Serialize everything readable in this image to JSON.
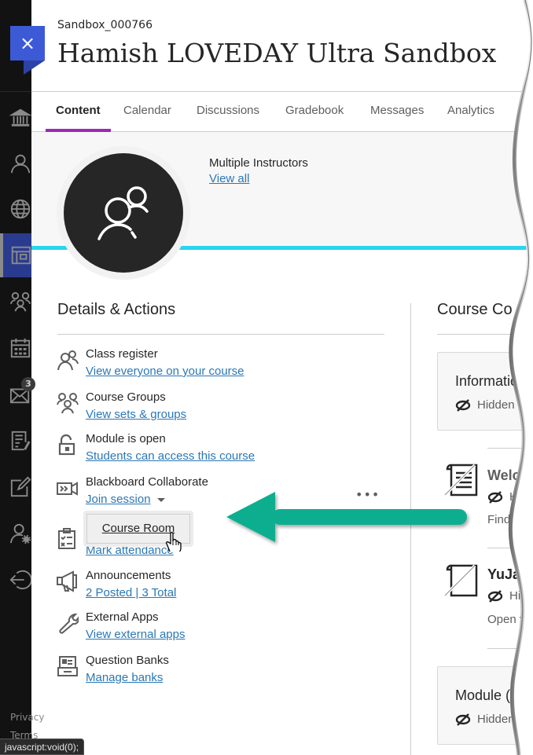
{
  "header": {
    "close_label": "×",
    "course_id": "Sandbox_000766",
    "course_title": "Hamish LOVEDAY Ultra Sandbox"
  },
  "tabs": [
    {
      "label": "Content",
      "active": true
    },
    {
      "label": "Calendar",
      "active": false
    },
    {
      "label": "Discussions",
      "active": false
    },
    {
      "label": "Gradebook",
      "active": false
    },
    {
      "label": "Messages",
      "active": false
    },
    {
      "label": "Analytics",
      "active": false
    }
  ],
  "rail": {
    "items": [
      {
        "icon": "institution-icon"
      },
      {
        "icon": "profile-icon"
      },
      {
        "icon": "globe-icon"
      },
      {
        "icon": "courses-icon",
        "active": true
      },
      {
        "icon": "groups-icon"
      },
      {
        "icon": "calendar-icon"
      },
      {
        "icon": "messages-icon",
        "badge": "3"
      },
      {
        "icon": "grades-icon"
      },
      {
        "icon": "edit-icon"
      },
      {
        "icon": "user-settings-icon"
      },
      {
        "icon": "sign-out-icon"
      }
    ],
    "footer": [
      "Privacy",
      "Terms"
    ]
  },
  "banner": {
    "instructors_label": "Multiple Instructors",
    "view_all": "View all",
    "accent_color": "#2bd4ef"
  },
  "details": {
    "title": "Details & Actions",
    "actions": [
      {
        "icon": "class-register-icon",
        "title": "Class register",
        "link": "View everyone on your course"
      },
      {
        "icon": "course-groups-icon",
        "title": "Course Groups",
        "link": "View sets & groups"
      },
      {
        "icon": "unlock-icon",
        "title": "Module is open",
        "link": "Students can access this course"
      },
      {
        "icon": "video-camera-icon",
        "title": "Blackboard Collaborate",
        "link": "Join session"
      },
      {
        "icon": "attendance-icon",
        "title": "",
        "link": "Mark attendance"
      },
      {
        "icon": "megaphone-icon",
        "title": "Announcements",
        "link": "2 Posted | 3 Total"
      },
      {
        "icon": "wrench-icon",
        "title": "External Apps",
        "link": "View external apps"
      },
      {
        "icon": "question-bank-icon",
        "title": "Question Banks",
        "link": "Manage banks"
      }
    ],
    "more_label": "•••",
    "dropdown": {
      "items": [
        "Course Room"
      ]
    }
  },
  "content": {
    "title": "Course Co",
    "cards": [
      {
        "title": "Informatio",
        "visibility": "Hidden fr"
      },
      {
        "title": "Module (",
        "visibility": "Hidden"
      }
    ],
    "items": [
      {
        "title": "Welc",
        "visibility": "H",
        "desc": "Find"
      },
      {
        "title": "YuJa: (",
        "visibility": "Hidd",
        "desc": "Open yo"
      }
    ]
  },
  "annotation": {
    "arrow_color": "#0aae8f"
  },
  "status_bar": {
    "url": "javascript:void(0);"
  }
}
